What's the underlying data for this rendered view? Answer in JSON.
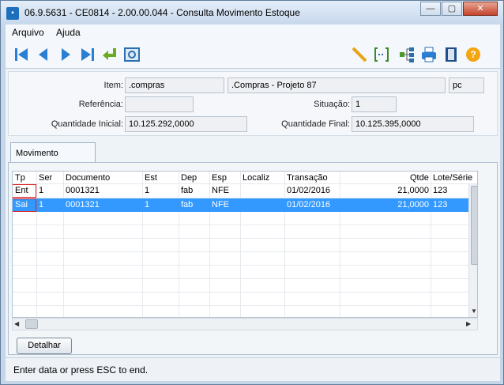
{
  "window": {
    "title": "06.9.5631 - CE0814 - 2.00.00.044 - Consulta Movimento Estoque"
  },
  "menu": [
    "Arquivo",
    "Ajuda"
  ],
  "toolbar": {
    "left": [
      "first-icon",
      "prev-icon",
      "next-icon",
      "last-icon",
      "return-icon",
      "zoom-icon"
    ],
    "right": [
      "edit-icon",
      "range-icon",
      "tree-icon",
      "print-icon",
      "exit-icon",
      "help-icon"
    ]
  },
  "header": {
    "item_label": "Item:",
    "item_code": ".compras",
    "item_desc": ".Compras - Projeto 87",
    "unit": "pc",
    "referencia_label": "Referência:",
    "referencia": "",
    "situacao_label": "Situação:",
    "situacao": "1",
    "qtd_inicial_label": "Quantidade Inicial:",
    "qtd_inicial": "10.125.292,0000",
    "qtd_final_label": "Quantidade Final:",
    "qtd_final": "10.125.395,0000"
  },
  "tab": {
    "label": "Movimento"
  },
  "grid": {
    "columns": [
      "Tp",
      "Ser",
      "Documento",
      "Est",
      "Dep",
      "Esp",
      "Localiz",
      "Transação",
      "Qtde",
      "Lote/Série"
    ],
    "rows": [
      {
        "tp": "Ent",
        "ser": "1",
        "doc": "0001321",
        "est": "1",
        "dep": "fab",
        "esp": "NFE",
        "localiz": "",
        "trans": "01/02/2016",
        "qtde": "21,0000",
        "lote": "123"
      },
      {
        "tp": "Sai",
        "ser": "1",
        "doc": "0001321",
        "est": "1",
        "dep": "fab",
        "esp": "NFE",
        "localiz": "",
        "trans": "01/02/2016",
        "qtde": "21,0000",
        "lote": "123"
      }
    ]
  },
  "buttons": {
    "detalhar": "Detalhar"
  },
  "status": "Enter data or press ESC to end.",
  "colors": {
    "selection": "#3399ff",
    "accent_yellow": "#f4a512",
    "highlight_border": "#e02020"
  }
}
